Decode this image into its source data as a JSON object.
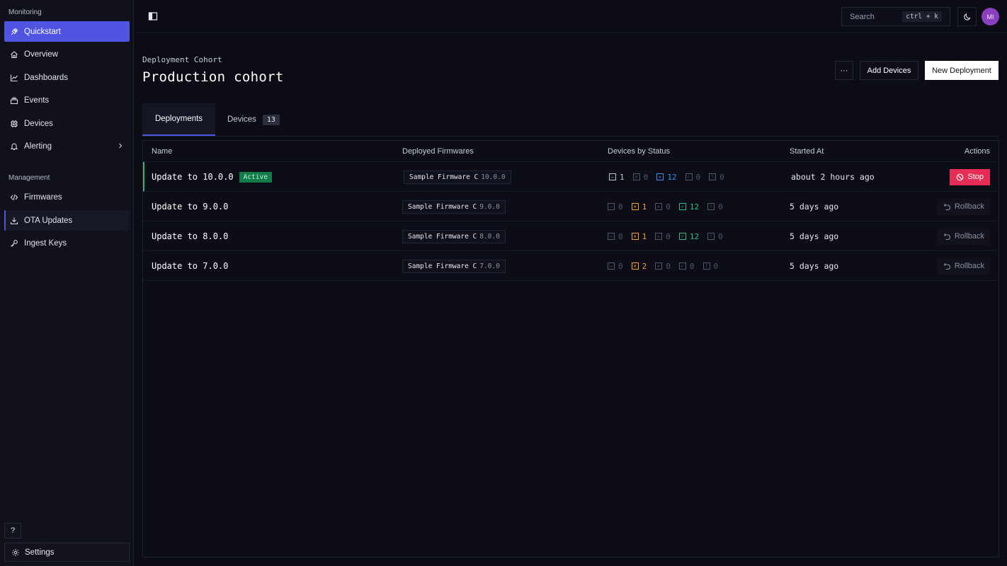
{
  "sidebar": {
    "section_monitoring": "Monitoring",
    "section_management": "Management",
    "items": [
      {
        "label": "Quickstart"
      },
      {
        "label": "Overview"
      },
      {
        "label": "Dashboards"
      },
      {
        "label": "Events"
      },
      {
        "label": "Devices"
      },
      {
        "label": "Alerting"
      },
      {
        "label": "Firmwares"
      },
      {
        "label": "OTA Updates"
      },
      {
        "label": "Ingest Keys"
      }
    ],
    "help_label": "?",
    "settings_label": "Settings"
  },
  "topbar": {
    "search_placeholder": "Search",
    "search_shortcut": "ctrl + k",
    "avatar_initials": "MI"
  },
  "header": {
    "eyebrow": "Deployment Cohort",
    "title": "Production cohort",
    "more_label": "···",
    "add_devices_label": "Add Devices",
    "new_deployment_label": "New Deployment"
  },
  "tabs": {
    "deployments": "Deployments",
    "devices": "Devices",
    "devices_count": "13"
  },
  "table": {
    "headers": {
      "name": "Name",
      "firmwares": "Deployed Firmwares",
      "status": "Devices by Status",
      "started": "Started At",
      "actions": "Actions"
    },
    "rows": [
      {
        "name": "Update to 10.0.0",
        "badge": "Active",
        "firmware": "Sample Firmware C",
        "version": "10.0.0",
        "s1": "1",
        "s2": "0",
        "s3": "12",
        "s4": "0",
        "s5": "0",
        "started": "about 2 hours ago",
        "action": "Stop"
      },
      {
        "name": "Update to 9.0.0",
        "firmware": "Sample Firmware C",
        "version": "9.0.0",
        "s1": "0",
        "s2": "1",
        "s3": "0",
        "s4": "12",
        "s5": "0",
        "started": "5 days ago",
        "action": "Rollback"
      },
      {
        "name": "Update to 8.0.0",
        "firmware": "Sample Firmware C",
        "version": "8.0.0",
        "s1": "0",
        "s2": "1",
        "s3": "0",
        "s4": "12",
        "s5": "0",
        "started": "5 days ago",
        "action": "Rollback"
      },
      {
        "name": "Update to 7.0.0",
        "firmware": "Sample Firmware C",
        "version": "7.0.0",
        "s1": "0",
        "s2": "2",
        "s3": "0",
        "s4": "0",
        "s5": "0",
        "started": "5 days ago",
        "action": "Rollback"
      }
    ]
  },
  "colors": {
    "accent": "#4f55e0",
    "active_green": "#2fb67a",
    "stop_red": "#e52d55",
    "status_orange": "#f0a43a",
    "status_blue": "#3e8ef0",
    "status_green": "#27c281"
  }
}
